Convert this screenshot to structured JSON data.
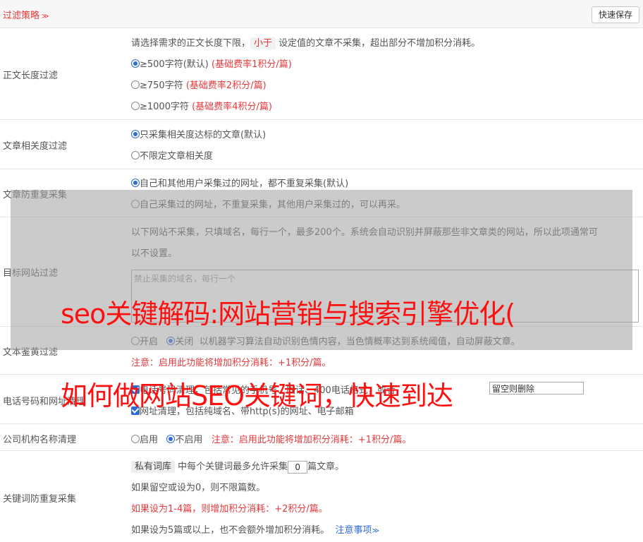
{
  "header": {
    "title": "过滤策略",
    "chevron": "≫",
    "save_label": "快速保存"
  },
  "length_filter": {
    "label": "正文长度过滤",
    "desc_pre": "请选择需求的正文长度下限，",
    "desc_tag": "小于",
    "desc_post": "设定值的文章不采集，超出部分不增加积分消耗。",
    "options": [
      {
        "text": "≥500字符(默认)",
        "note": "(基础费率1积分/篇)",
        "selected": true
      },
      {
        "text": "≥750字符",
        "note": "(基础费率2积分/篇)",
        "selected": false
      },
      {
        "text": "≥1000字符",
        "note": "(基础费率4积分/篇)",
        "selected": false
      }
    ]
  },
  "relevance_filter": {
    "label": "文章相关度过滤",
    "options": [
      {
        "text": "只采集相关度达标的文章(默认)",
        "selected": true
      },
      {
        "text": "不限定文章相关度",
        "selected": false
      }
    ]
  },
  "dedupe_filter": {
    "label": "文章防重复采集",
    "options": [
      {
        "text": "自己和其他用户采集过的网址，都不重复采集(默认)",
        "selected": true
      },
      {
        "text": "自己采集过的网址，不重复采集，其他用户采集过的，可以再采。",
        "selected": false
      }
    ]
  },
  "site_filter": {
    "label": "目标网站过滤",
    "desc_line1": "以下网站不采集，只填域名，每行一个，最多200个。系统会自动识别并屏蔽那些非文章类的网站，所以此项通常可",
    "desc_line2": "以不设置。",
    "placeholder": "禁止采集的域名，每行一个"
  },
  "porn_filter": {
    "label": "文本鉴黄过滤",
    "on_label": "开启",
    "off_label": "关闭",
    "selected": "off",
    "desc": "以机器学习算法自动识别色情内容，当色情概率达到系统阈值，自动屏蔽文章。",
    "note": "注意：启用此功能将增加积分消耗：+1积分/篇。"
  },
  "phone_filter": {
    "label": "电话号码和网址清理",
    "phone_text": "电话号码清理，包括常见的手机号、固话、400电话格式，或者",
    "input_value": "留空则删除",
    "url_text": "网址清理，包括纯域名、带http(s)的网址、电子邮箱"
  },
  "company_filter": {
    "label": "公司机构名称清理",
    "on_label": "启用",
    "off_label": "不启用",
    "selected": "off",
    "note": "注意：启用此功能将增加积分消耗：+1积分/篇。"
  },
  "keyword_filter": {
    "label": "关键词防重复采集",
    "tag": "私有词库",
    "line1_mid": "中每个关键词最多允许采集",
    "count": "0",
    "line1_post": "篇文章。",
    "line2": "如果留空或设为0，则不限篇数。",
    "line3": "如果设为1-4篇，则增加积分消耗：+2积分/篇。",
    "line4": "如果设为5篇或以上，也不会额外增加积分消耗。",
    "note_link": "注意事项",
    "note_chevron": "≫"
  },
  "watermark": {
    "line1": "seo关键解码:网站营销与搜索引擎优化(",
    "line2": "如何做网站SEO关键词，快速到达"
  }
}
